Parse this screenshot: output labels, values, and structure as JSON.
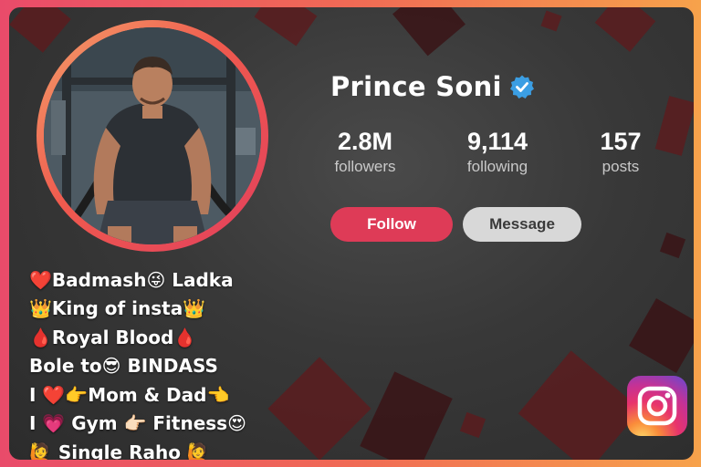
{
  "profile": {
    "name": "Prince Soni",
    "verified": true
  },
  "stats": [
    {
      "value": "2.8M",
      "label": "followers"
    },
    {
      "value": "9,114",
      "label": "following"
    },
    {
      "value": "157",
      "label": "posts"
    }
  ],
  "actions": {
    "follow_label": "Follow",
    "message_label": "Message"
  },
  "bio": [
    "❤️Badmash😜 Ladka",
    "👑King of insta👑",
    "🩸Royal Blood🩸",
    "Bole to😎 BINDASS",
    "I ❤️👉Mom & Dad👈",
    "I 💗 Gym 👉🏻 Fitness😍",
    "🙋 Single Raho 🙋"
  ],
  "icons": {
    "badge": "verified-check-icon",
    "app": "instagram-logo-icon"
  },
  "colors": {
    "follow": "#de3b57",
    "message": "#d8d8d8",
    "verified": "#3b9ee3",
    "frame_gradient": [
      "#e94b6a",
      "#f7a24b"
    ]
  }
}
